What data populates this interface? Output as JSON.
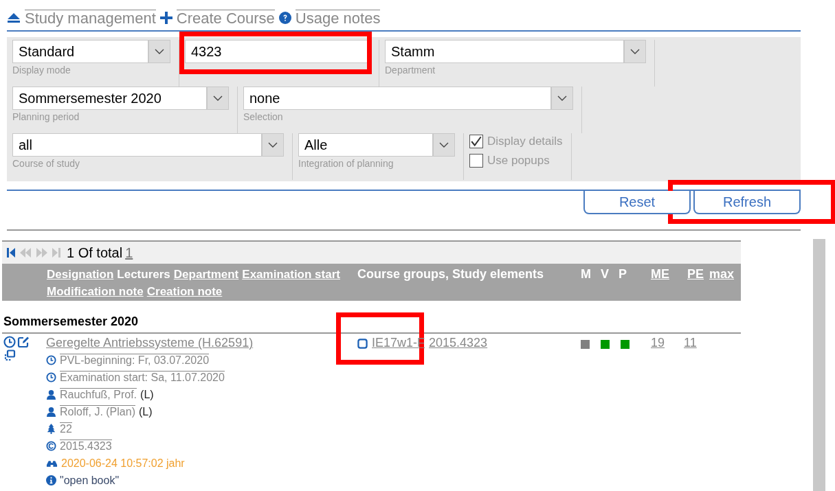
{
  "nav_links": [
    {
      "kind": "eject",
      "label": "Study management"
    },
    {
      "kind": "plus",
      "label": "Create Course"
    },
    {
      "kind": "help",
      "label": "Usage notes"
    }
  ],
  "filter_rows": [
    [
      {
        "kind": "select",
        "value": "Standard",
        "label": "Display mode"
      },
      {
        "kind": "input",
        "value": "4323",
        "highlighted": true
      },
      {
        "kind": "select",
        "value": "Stamm",
        "label": "Department"
      }
    ],
    [
      {
        "kind": "select",
        "value": "Sommersemester 2020",
        "label": "Planning period"
      },
      {
        "kind": "select",
        "value": "none",
        "label": "Selection"
      }
    ],
    [
      {
        "kind": "select",
        "value": "all",
        "label": "Course of study"
      },
      {
        "kind": "select",
        "value": "Alle",
        "label": "Integration of planning"
      },
      {
        "kind": "checks",
        "items": [
          {
            "label": "Display details",
            "checked": true
          },
          {
            "label": "Use popups",
            "checked": false
          }
        ]
      }
    ]
  ],
  "buttons": [
    {
      "label": "Reset",
      "highlighted": false
    },
    {
      "label": "Refresh",
      "highlighted": true
    }
  ],
  "pager": {
    "text": "1 Of total",
    "page": "1"
  },
  "header": {
    "fields": [
      {
        "label": "Designation",
        "sortable": true
      },
      {
        "label": "Lecturers",
        "sortable": false
      },
      {
        "label": "Department",
        "sortable": true
      },
      {
        "label": "Examination start",
        "sortable": true
      },
      {
        "label": "Modification note",
        "sortable": true
      },
      {
        "label": "Creation note",
        "sortable": true
      }
    ],
    "groups_column": "Course groups, Study elements",
    "flags": [
      {
        "label": "M",
        "sortable": false
      },
      {
        "label": "V",
        "sortable": false
      },
      {
        "label": "P",
        "sortable": false
      }
    ],
    "counts": [
      {
        "label": "ME",
        "sortable": true
      },
      {
        "label": "PE",
        "sortable": true
      },
      {
        "label": "max",
        "sortable": true
      }
    ]
  },
  "group_title": "Sommersemester 2020",
  "rows": [
    {
      "title": "Geregelte Antriebssysteme (H.62591)",
      "details": [
        {
          "kind": "clock",
          "text": "PVL-beginning: Fr, 03.07.2020"
        },
        {
          "kind": "clock",
          "text": "Examination start: Sa, 11.07.2020"
        },
        {
          "kind": "person",
          "text": "Rauchfuß, Prof.",
          "role": "(L)"
        },
        {
          "kind": "person",
          "text": "Roloff, J. (Plan)",
          "role": "(L)"
        },
        {
          "kind": "tree",
          "text": "22"
        },
        {
          "kind": "code",
          "text": "2015.4323"
        },
        {
          "kind": "modified",
          "text": "2020-06-24 10:57:02 jahr"
        },
        {
          "kind": "info",
          "text": "\"open book\""
        }
      ],
      "course_groups": [
        {
          "label": "IE17w1-F",
          "highlighted": true
        },
        {
          "label": "2015.4323",
          "highlighted": false
        }
      ],
      "flags": [
        {
          "color": "#808080"
        },
        {
          "color": "#009900"
        },
        {
          "color": "#009900"
        }
      ],
      "counts": [
        "19",
        "11"
      ]
    }
  ]
}
